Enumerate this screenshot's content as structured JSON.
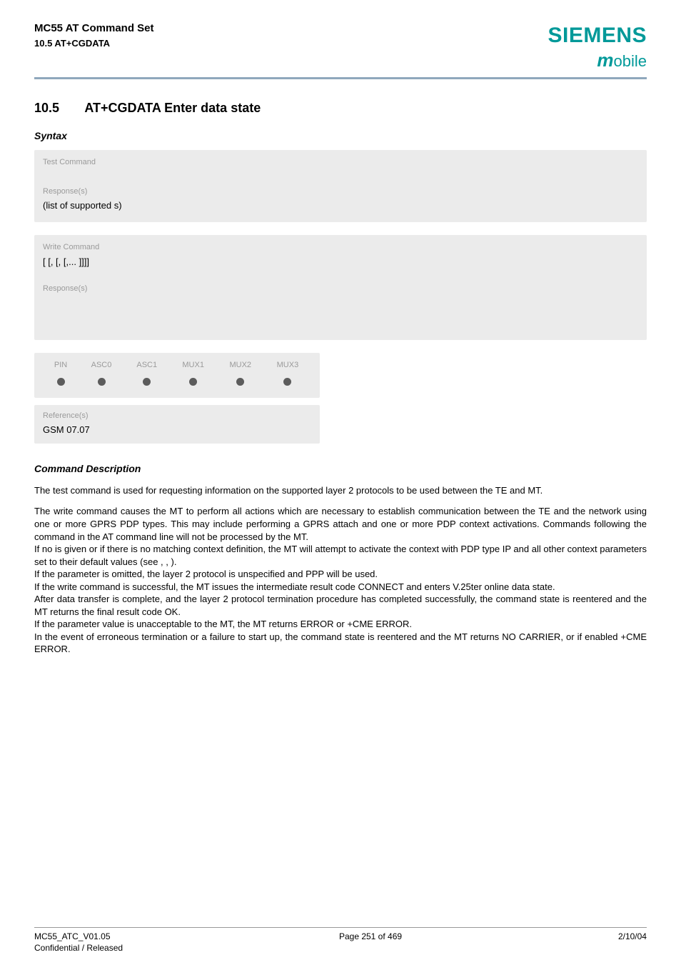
{
  "header": {
    "title": "MC55 AT Command Set",
    "subtitle": "10.5 AT+CGDATA",
    "brand_main": "SIEMENS",
    "brand_sub_m": "m",
    "brand_sub_rest": "obile"
  },
  "section": {
    "number": "10.5",
    "title": "AT+CGDATA   Enter data state"
  },
  "syntax_label": "Syntax",
  "blocks": {
    "test_cmd_label": "Test Command",
    "response_label": "Response(s)",
    "response1_text": "(list of supported        s)",
    "write_cmd_label": "Write Command",
    "write_cmd_text": "[         [,         [,           [,... ]]]]",
    "matrix_headers": [
      "PIN",
      "ASC0",
      "ASC1",
      "MUX1",
      "MUX2",
      "MUX3"
    ],
    "refs_label": "Reference(s)",
    "refs_text": "GSM 07.07"
  },
  "cmd_desc_label": "Command Description",
  "paragraphs": {
    "p1": "The test command is used for requesting information on the supported layer 2 protocols to be used between the TE and MT.",
    "p2": "The write command causes the MT to perform all actions which are necessary to establish communication between the TE and the network using one or more GPRS PDP types. This may include performing a GPRS attach and one or more PDP context activations. Commands following the                      command in the AT command line will not be processed by the MT.",
    "p3": "If no           is given or if there is no matching context definition, the MT will attempt to activate the context with PDP type IP and all other context parameters set to their default values (see                       ,                       ,                     ).",
    "p4": "If the            parameter is omitted, the layer 2 protocol is unspecified and PPP will be used.",
    "p5": "If the write command is successful, the MT issues the intermediate result code CONNECT and enters V.25ter online data state.",
    "p6": "After data transfer is complete, and the layer 2 protocol termination procedure has completed successfully, the command state is reentered and the MT returns the final result code OK.",
    "p7": "If the            parameter value is unacceptable to the MT, the MT returns ERROR or +CME ERROR.",
    "p8": "In the event of erroneous termination or a failure to start up, the command state is reentered and the MT returns NO CARRIER, or if enabled +CME ERROR."
  },
  "footer": {
    "left1": "MC55_ATC_V01.05",
    "left2": "Confidential / Released",
    "center": "Page 251 of 469",
    "right": "2/10/04"
  }
}
